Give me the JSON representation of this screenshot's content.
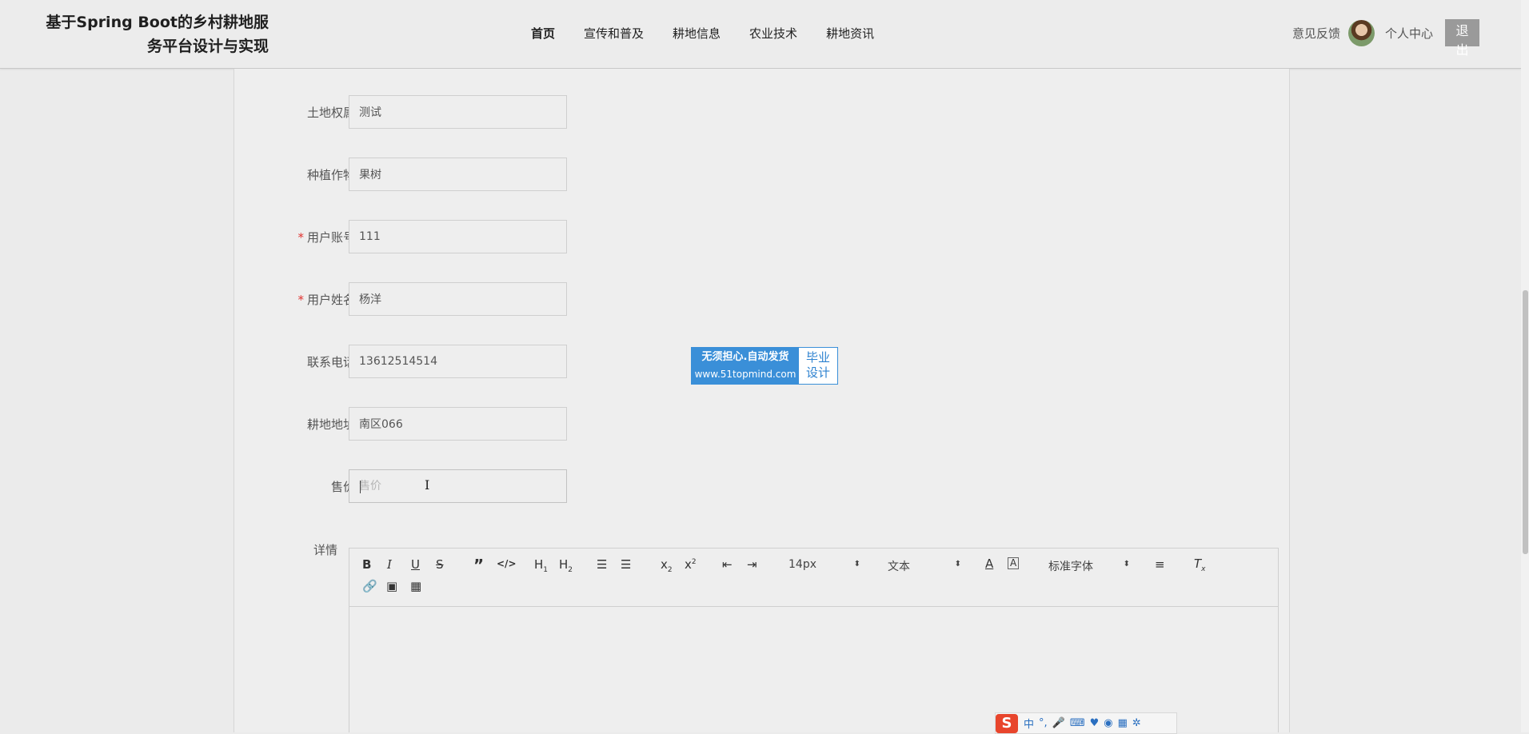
{
  "header": {
    "title_line1": "基于Spring Boot的乡村耕地服",
    "title_line2": "务平台设计与实现",
    "nav": [
      "首页",
      "宣传和普及",
      "耕地信息",
      "农业技术",
      "耕地资讯"
    ],
    "feedback": "意见反馈",
    "personal_center": "个人中心",
    "logout": "退出"
  },
  "form": {
    "rows": [
      {
        "label": "土地权属",
        "value": "测试",
        "required": false
      },
      {
        "label": "种植作物",
        "value": "果树",
        "required": false
      },
      {
        "label": "用户账号",
        "value": "111",
        "required": true
      },
      {
        "label": "用户姓名",
        "value": "杨洋",
        "required": true
      },
      {
        "label": "联系电话",
        "value": "13612514514",
        "required": false
      },
      {
        "label": "耕地地址",
        "value": "南区066",
        "required": false
      }
    ],
    "price_label": "售价",
    "price_placeholder": "售价",
    "required_mark": "*",
    "detail_label": "详情"
  },
  "editor": {
    "font_size": "14px",
    "text_type": "文本",
    "font_family": "标准字体"
  },
  "ad": {
    "line1": "无须担心.自动发货",
    "line2": "www.51topmind.com",
    "right_line1": "毕业",
    "right_line2": "设计"
  },
  "ime": {
    "logo": "S",
    "mode": "中"
  }
}
